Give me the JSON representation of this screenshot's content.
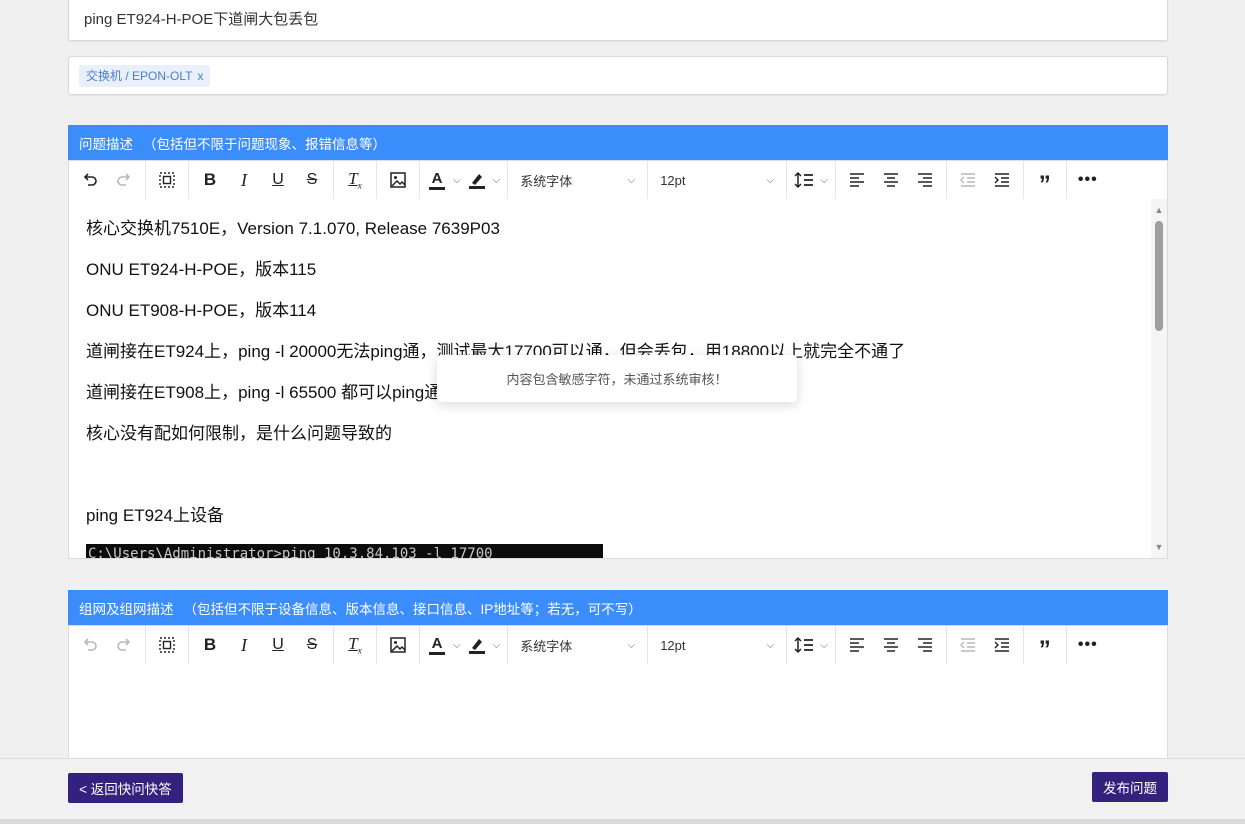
{
  "title_field": {
    "value": "ping ET924-H-POE下道闸大包丢包"
  },
  "tags": [
    {
      "label": "交换机 / EPON-OLT",
      "remove": "x"
    }
  ],
  "description_section": {
    "header": "问题描述",
    "hint": "（包括但不限于问题现象、报错信息等）"
  },
  "network_section": {
    "header": "组网及组网描述",
    "hint": "（包括但不限于设备信息、版本信息、接口信息、IP地址等；若无，可不写）"
  },
  "toolbar": {
    "font_family": "系统字体",
    "font_size": "12pt",
    "icons": [
      "undo-icon",
      "redo-icon",
      "select-all-icon",
      "bold-icon",
      "italic-icon",
      "underline-icon",
      "strikethrough-icon",
      "clear-format-icon",
      "image-icon",
      "font-color-icon",
      "highlight-color-icon",
      "line-height-icon",
      "align-left-icon",
      "align-center-icon",
      "align-right-icon",
      "outdent-icon",
      "indent-icon",
      "blockquote-icon",
      "more-icon"
    ]
  },
  "editor_content": {
    "lines": [
      "核心交换机7510E，Version 7.1.070, Release 7639P03",
      "ONU ET924-H-POE，版本115",
      "ONU ET908-H-POE，版本114",
      "道闸接在ET924上，ping -l 20000无法ping通，测试最大17700可以通，但会丢包，用18800以上就完全不通了",
      "道闸接在ET908上，ping -l 65500 都可以ping通",
      "核心没有配如何限制，是什么问题导致的",
      "",
      "ping ET924上设备"
    ],
    "cmd_line": "C:\\Users\\Administrator>ping 10.3.84.103 -l 17700"
  },
  "toast": {
    "message": "内容包含敏感字符，未通过系统审核！"
  },
  "footer": {
    "back_button": "< 返回快问快答",
    "publish_button": "发布问题"
  },
  "colors": {
    "section_header_bg": "#3c8dfc",
    "button_bg": "#33227d",
    "tag_bg": "#e9f0fb",
    "tag_text": "#4a7fc9"
  }
}
